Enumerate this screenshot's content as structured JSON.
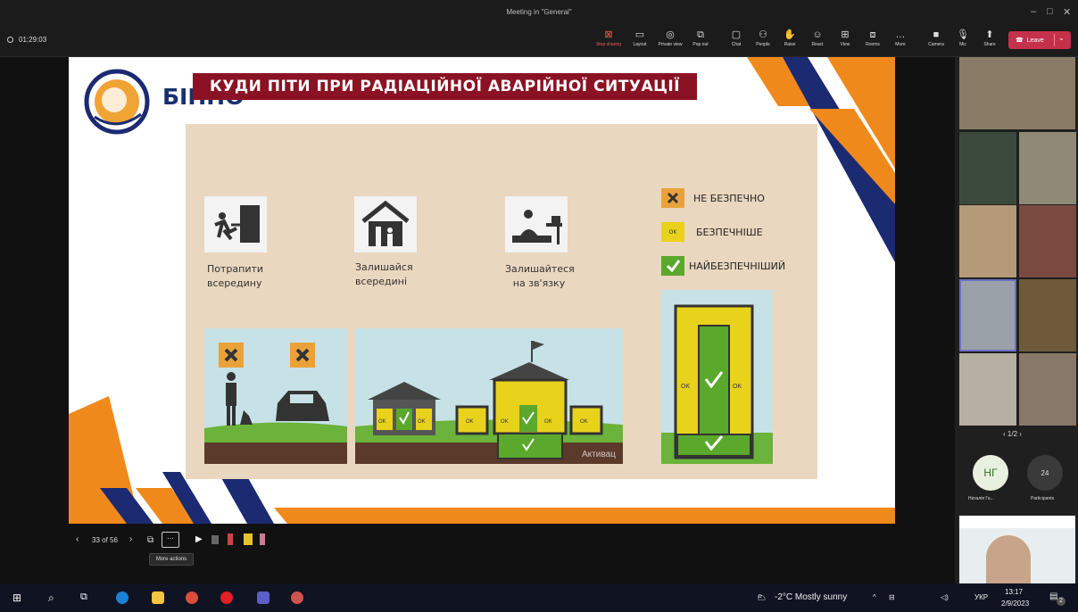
{
  "window": {
    "title": "Meeting in \"General\"",
    "controls": [
      "–",
      "□",
      "✕"
    ]
  },
  "meeting": {
    "timer": "01:29:03"
  },
  "toolbar": {
    "buttons": [
      {
        "label": "Stop sharing",
        "icon": "stop-share-icon"
      },
      {
        "label": "Layout",
        "icon": "layout-icon"
      },
      {
        "label": "Private view",
        "icon": "eye-icon"
      },
      {
        "label": "Pop out",
        "icon": "popout-icon"
      },
      {
        "label": "Chat",
        "icon": "chat-icon"
      },
      {
        "label": "People",
        "icon": "people-icon"
      },
      {
        "label": "Raise",
        "icon": "hand-icon"
      },
      {
        "label": "React",
        "icon": "smile-icon"
      },
      {
        "label": "View",
        "icon": "grid-icon"
      },
      {
        "label": "Rooms",
        "icon": "rooms-icon"
      },
      {
        "label": "More",
        "icon": "more-icon"
      },
      {
        "label": "Camera",
        "icon": "camera-icon"
      },
      {
        "label": "Mic",
        "icon": "mic-icon"
      },
      {
        "label": "Share",
        "icon": "share-icon"
      }
    ],
    "leave_label": "Leave"
  },
  "slide": {
    "logo_text": "БІНПО",
    "title": "КУДИ ПІТИ ПРИ РАДІАЦІЙНОЇ АВАРІЙНОЇ СИТУАЦІЇ",
    "captions": {
      "get_inside": [
        "Потрапити",
        "всередину"
      ],
      "stay_inside": [
        "Залишайся",
        "всередині"
      ],
      "stay_connected": [
        "Залишайтеся",
        "на зв'язку"
      ]
    },
    "legend": {
      "unsafe": "НЕ БЕЗПЕЧНО",
      "safer": "БЕЗПЕЧНІШЕ",
      "safest": "НАЙБЕЗПЕЧНІШИЙ",
      "ok": "OK"
    },
    "watermark": "Активац"
  },
  "slide_controls": {
    "counter": "33 of 56",
    "tooltip": "More actions"
  },
  "participants": {
    "pager": "1/2",
    "initials": "НГ",
    "name_short": "Наталія Га...",
    "count": "24",
    "count_label": "Participants"
  },
  "taskbar": {
    "weather": "-2°C  Mostly sunny",
    "lang": "УКР",
    "time": "13:17",
    "date": "2/9/2023",
    "notif_count": "2"
  },
  "colors": {
    "orange": "#f0891b",
    "navy": "#1c2a72",
    "leave_red": "#c4314b",
    "green_ok": "#5aa82c",
    "yellow_ok": "#e9d21c"
  }
}
